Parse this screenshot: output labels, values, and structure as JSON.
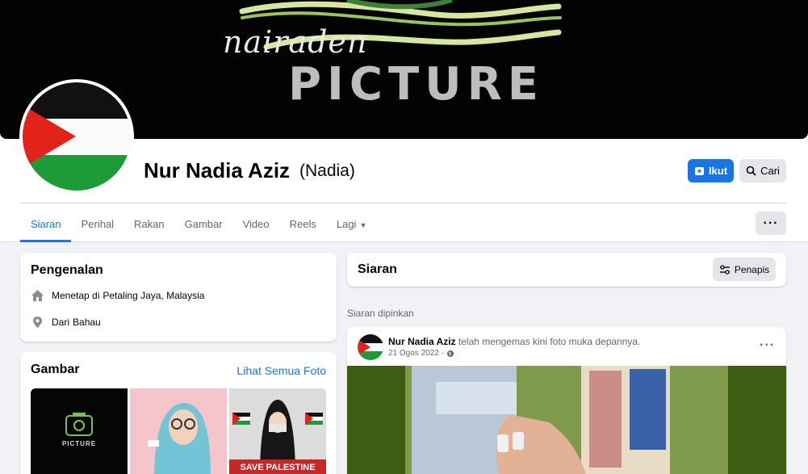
{
  "cover": {
    "script_text": "nairaden",
    "big_text": "PICTURE"
  },
  "profile": {
    "name": "Nur Nadia Aziz",
    "nickname": "(Nadia)",
    "follow_label": "Ikut",
    "search_label": "Cari",
    "more_label": "···"
  },
  "tabs": [
    {
      "label": "Siaran",
      "active": true
    },
    {
      "label": "Perihal"
    },
    {
      "label": "Rakan"
    },
    {
      "label": "Gambar"
    },
    {
      "label": "Video"
    },
    {
      "label": "Reels"
    },
    {
      "label": "Lagi"
    }
  ],
  "intro": {
    "title": "Pengenalan",
    "lives_prefix": "Menetap di",
    "lives_place": "Petaling Jaya, Malaysia",
    "from_prefix": "Dari",
    "from_place": "Bahau"
  },
  "photos": {
    "title": "Gambar",
    "see_all": "Lihat Semua Foto",
    "thumb1_text": "PICTURE",
    "thumb3_text": "SAVE PALESTINE"
  },
  "posts": {
    "title": "Siaran",
    "filter_label": "Penapis",
    "pinned_label": "Siaran dipinkan"
  },
  "post": {
    "author": "Nur Nadia Aziz",
    "action": "telah mengemas kini foto muka depannya.",
    "date": "21 Ogos 2022 ·",
    "more": "···"
  },
  "colors": {
    "accent": "#1b74e4",
    "page_bg": "#f0f2f5",
    "flag_red": "#e2231a",
    "flag_green": "#1e9b38",
    "cover_swirl": "#d5e6a0"
  },
  "icons": [
    "follow-icon",
    "search-icon",
    "filter-icon",
    "home-icon",
    "location-icon",
    "globe-icon",
    "caret-down-icon"
  ]
}
